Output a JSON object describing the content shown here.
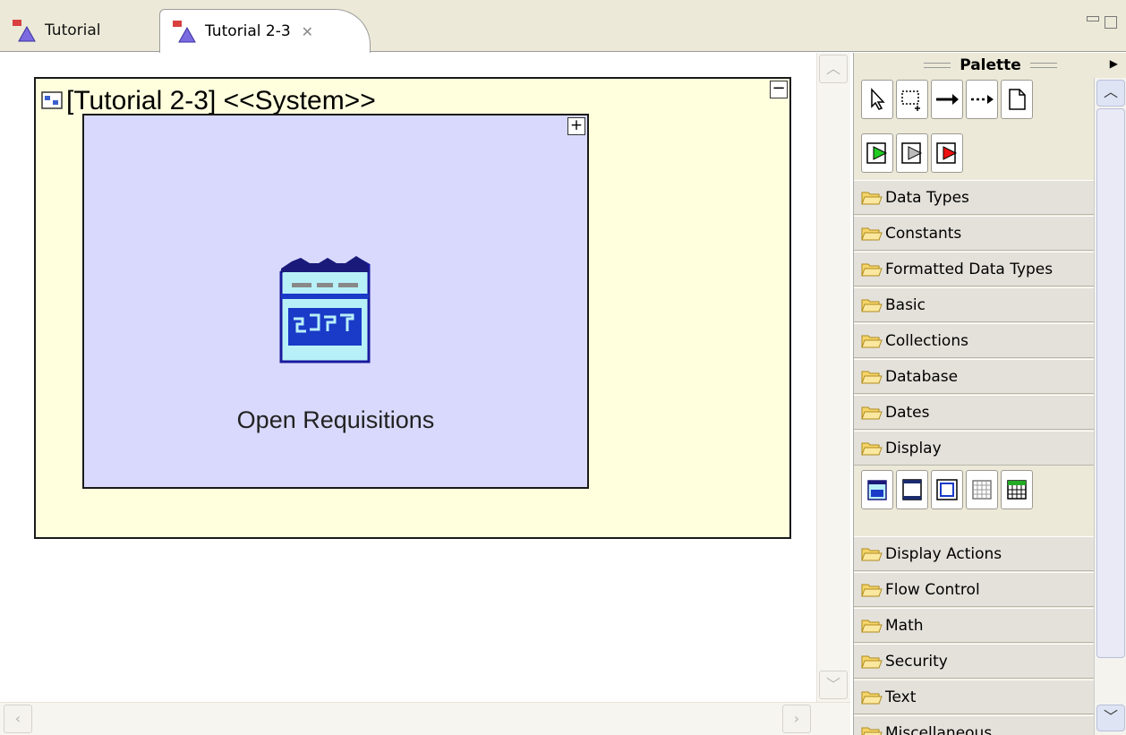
{
  "tabs": [
    {
      "label": "Tutorial",
      "active": false
    },
    {
      "label": "Tutorial 2-3",
      "active": true
    }
  ],
  "window_controls": {
    "minimize_icon": "minimize-icon",
    "maximize_icon": "maximize-icon"
  },
  "canvas": {
    "system_title": "[Tutorial 2-3] <<System>>",
    "collapse_label": "−",
    "display_expand_label": "+",
    "display_label": "Open Requisitions"
  },
  "palette": {
    "title": "Palette",
    "tools": [
      "select-tool",
      "marquee-tool",
      "connection-tool",
      "dashed-connection-tool",
      "note-tool"
    ],
    "flow_tools": [
      "start-event-tool",
      "gateway-tool",
      "end-event-tool"
    ],
    "drawers": [
      "Data Types",
      "Constants",
      "Formatted Data Types",
      "Basic",
      "Collections",
      "Database",
      "Dates",
      "Display",
      "Display Actions",
      "Flow Control",
      "Math",
      "Security",
      "Text",
      "Miscellaneous"
    ],
    "display_tools": [
      "display-page-tool",
      "frame-tool",
      "panel-tool",
      "grid-tool",
      "table-tool"
    ]
  },
  "colors": {
    "system_fill": "#ffffde",
    "display_fill": "#d8d9fc",
    "chrome": "#ece9d8"
  }
}
